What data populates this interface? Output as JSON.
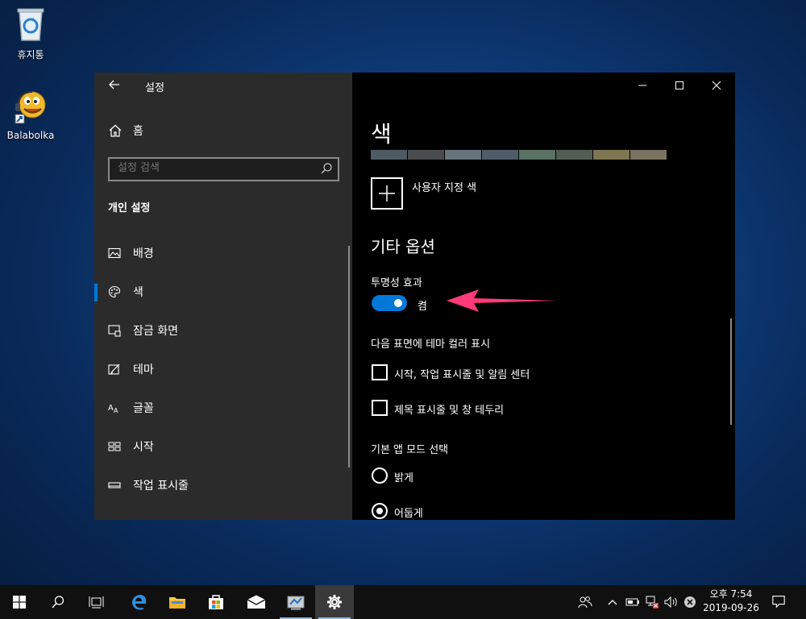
{
  "desktop": {
    "icons": [
      {
        "label": "휴지통",
        "icon": "recycle-bin-icon"
      },
      {
        "label": "Balabolka",
        "icon": "balabolka-icon"
      }
    ]
  },
  "settings": {
    "title": "설정",
    "home_label": "홈",
    "search_placeholder": "설정 검색",
    "section_title": "개인 설정",
    "nav": [
      {
        "label": "배경",
        "icon": "picture-icon",
        "active": false
      },
      {
        "label": "색",
        "icon": "palette-icon",
        "active": true
      },
      {
        "label": "잠금 화면",
        "icon": "lock-screen-icon",
        "active": false
      },
      {
        "label": "테마",
        "icon": "theme-icon",
        "active": false
      },
      {
        "label": "글꼴",
        "icon": "font-icon",
        "active": false
      },
      {
        "label": "시작",
        "icon": "start-icon",
        "active": false
      },
      {
        "label": "작업 표시줄",
        "icon": "taskbar-icon",
        "active": false
      }
    ],
    "main": {
      "heading": "색",
      "swatch_colors": [
        "#4f5b62",
        "#4a4c4e",
        "#67747c",
        "#515c6b",
        "#5a7163",
        "#525e54",
        "#7e7552",
        "#7a7361"
      ],
      "custom_color_label": "사용자 지정 색",
      "other_options_heading": "기타 옵션",
      "transparency_label": "투명성 효과",
      "transparency_state": "켬",
      "accent_surfaces_label": "다음 표면에 테마 컬러 표시",
      "checkboxes": [
        {
          "label": "시작, 작업 표시줄 및 알림 센터",
          "checked": false
        },
        {
          "label": "제목 표시줄 및 창 테두리",
          "checked": false
        }
      ],
      "app_mode_label": "기본 앱 모드 선택",
      "radios": [
        {
          "label": "밝게",
          "selected": false
        },
        {
          "label": "어둡게",
          "selected": true
        }
      ]
    }
  },
  "taskbar": {
    "clock_period_time": "오후 7:54",
    "clock_date": "2019-09-26"
  },
  "colors": {
    "accent": "#0078d7",
    "annotation_arrow": "#ff3b7a"
  }
}
